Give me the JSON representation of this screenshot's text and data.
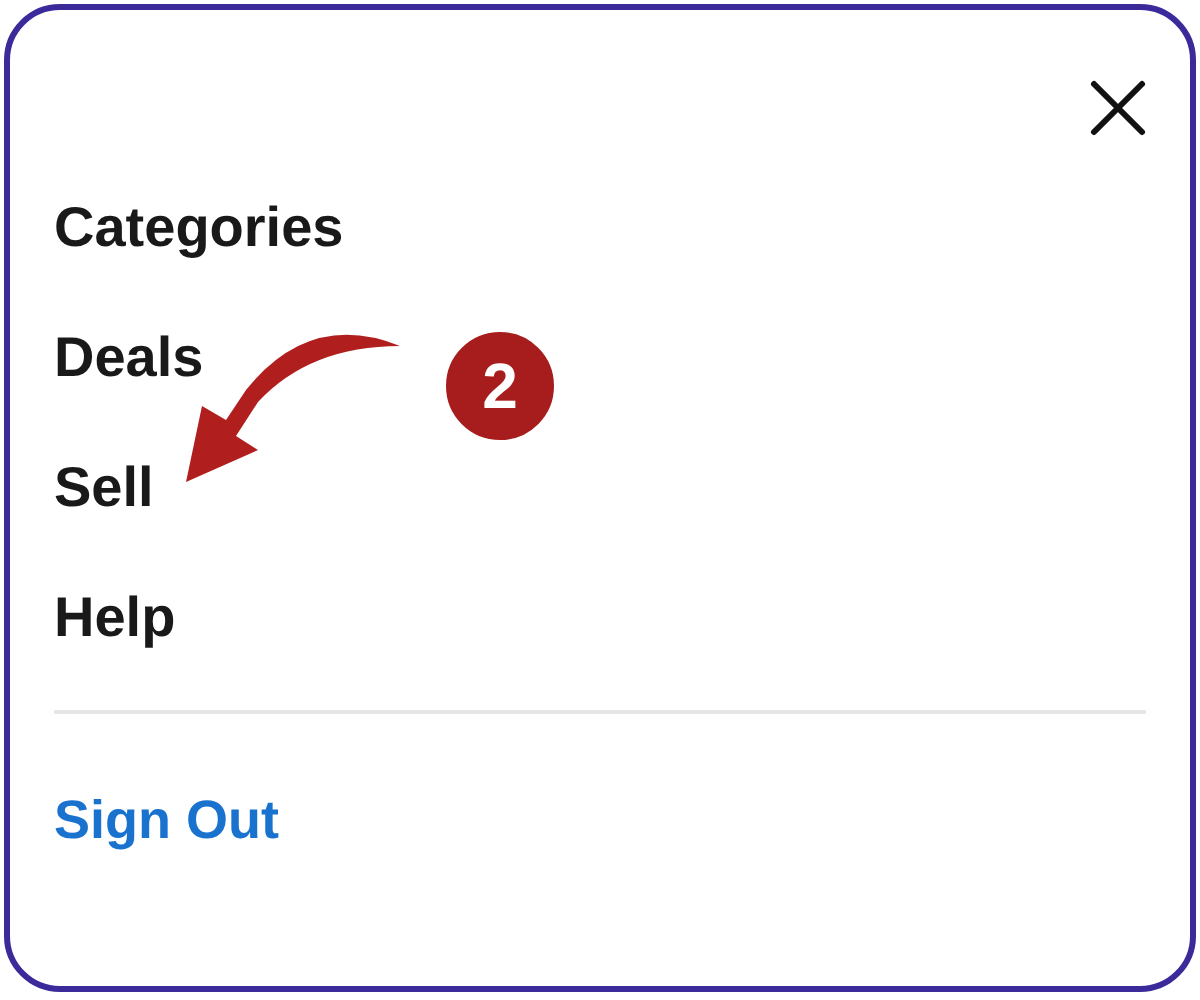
{
  "menu": {
    "items": [
      {
        "label": "Categories"
      },
      {
        "label": "Deals"
      },
      {
        "label": "Sell"
      },
      {
        "label": "Help"
      }
    ]
  },
  "sign_out": {
    "label": "Sign Out"
  },
  "annotation": {
    "number": "2"
  }
}
